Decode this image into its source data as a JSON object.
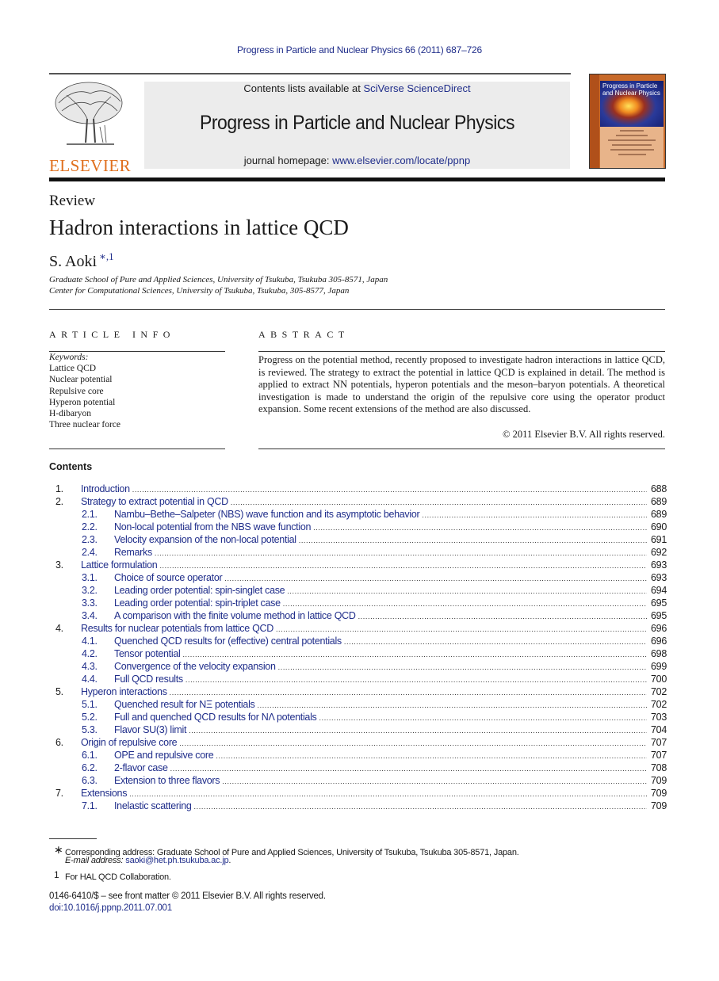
{
  "citation": "Progress in Particle and Nuclear Physics 66 (2011) 687–726",
  "publisher": "ELSEVIER",
  "banner": {
    "contents_prefix": "Contents lists available at ",
    "contents_link": "SciVerse ScienceDirect",
    "journal_title": "Progress in Particle and Nuclear Physics",
    "homepage_prefix": "journal homepage: ",
    "homepage_link": "www.elsevier.com/locate/ppnp"
  },
  "cover": {
    "title_line1": "Progress in Particle",
    "title_line2": "and Nuclear Physics"
  },
  "article": {
    "type": "Review",
    "title": "Hadron interactions in lattice QCD",
    "author": "S. Aoki",
    "author_marks": "∗,1",
    "affiliations": [
      "Graduate School of Pure and Applied Sciences, University of Tsukuba, Tsukuba 305-8571, Japan",
      "Center for Computational Sciences, University of Tsukuba, Tsukuba, 305-8577, Japan"
    ]
  },
  "article_info": {
    "heading": "ARTICLE INFO",
    "keywords_label": "Keywords:",
    "keywords": [
      "Lattice QCD",
      "Nuclear potential",
      "Repulsive core",
      "Hyperon potential",
      "H-dibaryon",
      "Three nuclear force"
    ]
  },
  "abstract": {
    "heading": "ABSTRACT",
    "text": "Progress on the potential method, recently proposed to investigate hadron interactions in lattice QCD, is reviewed. The strategy to extract the potential in lattice QCD is explained in detail. The method is applied to extract NN potentials, hyperon potentials and the meson–baryon potentials. A theoretical investigation is made to understand the origin of the repulsive core using the operator product expansion. Some recent extensions of the method are also discussed.",
    "copyright": "© 2011 Elsevier B.V. All rights reserved."
  },
  "contents": {
    "heading": "Contents",
    "items": [
      {
        "num": "1.",
        "label": "Introduction",
        "page": "688",
        "level": 1
      },
      {
        "num": "2.",
        "label": "Strategy to extract potential in QCD",
        "page": "689",
        "level": 1
      },
      {
        "num": "2.1.",
        "label": "Nambu–Bethe–Salpeter (NBS) wave function and its asymptotic behavior",
        "page": "689",
        "level": 2
      },
      {
        "num": "2.2.",
        "label": "Non-local potential from the NBS wave function",
        "page": "690",
        "level": 2
      },
      {
        "num": "2.3.",
        "label": "Velocity expansion of the non-local potential",
        "page": "691",
        "level": 2
      },
      {
        "num": "2.4.",
        "label": "Remarks",
        "page": "692",
        "level": 2
      },
      {
        "num": "3.",
        "label": "Lattice formulation",
        "page": "693",
        "level": 1
      },
      {
        "num": "3.1.",
        "label": "Choice of source operator",
        "page": "693",
        "level": 2
      },
      {
        "num": "3.2.",
        "label": "Leading order potential: spin-singlet case",
        "page": "694",
        "level": 2
      },
      {
        "num": "3.3.",
        "label": "Leading order potential: spin-triplet case",
        "page": "695",
        "level": 2
      },
      {
        "num": "3.4.",
        "label": "A comparison with the finite volume method in lattice QCD",
        "page": "695",
        "level": 2
      },
      {
        "num": "4.",
        "label": "Results for nuclear potentials from lattice QCD",
        "page": "696",
        "level": 1
      },
      {
        "num": "4.1.",
        "label": "Quenched QCD results for (effective) central potentials",
        "page": "696",
        "level": 2
      },
      {
        "num": "4.2.",
        "label": "Tensor potential",
        "page": "698",
        "level": 2
      },
      {
        "num": "4.3.",
        "label": "Convergence of the velocity expansion",
        "page": "699",
        "level": 2
      },
      {
        "num": "4.4.",
        "label": "Full QCD results",
        "page": "700",
        "level": 2
      },
      {
        "num": "5.",
        "label": "Hyperon interactions",
        "page": "702",
        "level": 1
      },
      {
        "num": "5.1.",
        "label": "Quenched result for NΞ potentials",
        "page": "702",
        "level": 2
      },
      {
        "num": "5.2.",
        "label": "Full and quenched QCD results for NΛ potentials",
        "page": "703",
        "level": 2
      },
      {
        "num": "5.3.",
        "label": "Flavor SU(3) limit",
        "page": "704",
        "level": 2
      },
      {
        "num": "6.",
        "label": "Origin of repulsive core",
        "page": "707",
        "level": 1
      },
      {
        "num": "6.1.",
        "label": "OPE and repulsive core",
        "page": "707",
        "level": 2
      },
      {
        "num": "6.2.",
        "label": "2-flavor case",
        "page": "708",
        "level": 2
      },
      {
        "num": "6.3.",
        "label": "Extension to three flavors",
        "page": "709",
        "level": 2
      },
      {
        "num": "7.",
        "label": "Extensions",
        "page": "709",
        "level": 1
      },
      {
        "num": "7.1.",
        "label": "Inelastic scattering",
        "page": "709",
        "level": 2
      }
    ]
  },
  "footnotes": {
    "corresponding_mark": "∗",
    "corresponding": "Corresponding address: Graduate School of Pure and Applied Sciences, University of Tsukuba, Tsukuba 305-8571, Japan.",
    "email_label": "E-mail address: ",
    "email": "saoki@het.ph.tsukuba.ac.jp",
    "email_suffix": ".",
    "collab_mark": "1",
    "collab": "For HAL QCD Collaboration."
  },
  "front_matter": "0146-6410/$ – see front matter © 2011 Elsevier B.V. All rights reserved.",
  "doi": "doi:10.1016/j.ppnp.2011.07.001"
}
